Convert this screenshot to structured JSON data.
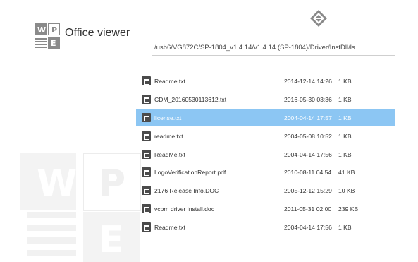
{
  "app": {
    "title": "Office viewer"
  },
  "path": "/usb6/VG872C/SP-1804_v1.4.14/v1.4.14 (SP-1804)/Driver/InstDll/ls",
  "files": [
    {
      "name": "Readme.txt",
      "date": "2014-12-14 14:26",
      "size": "1 KB",
      "selected": false
    },
    {
      "name": "CDM_20160530113612.txt",
      "date": "2016-05-30 03:36",
      "size": "1 KB",
      "selected": false
    },
    {
      "name": "license.txt",
      "date": "2004-04-14 17:57",
      "size": "1 KB",
      "selected": true
    },
    {
      "name": "readme.txt",
      "date": "2004-05-08 10:52",
      "size": "1 KB",
      "selected": false
    },
    {
      "name": "ReadMe.txt",
      "date": "2004-04-14 17:56",
      "size": "1 KB",
      "selected": false
    },
    {
      "name": "LogoVerificationReport.pdf",
      "date": "2010-08-11 04:54",
      "size": "41 KB",
      "selected": false
    },
    {
      "name": "2176 Release Info.DOC",
      "date": "2005-12-12 15:29",
      "size": "10 KB",
      "selected": false
    },
    {
      "name": "vcom driver install.doc",
      "date": "2011-05-31 02:00",
      "size": "239 KB",
      "selected": false
    },
    {
      "name": "Readme.txt",
      "date": "2004-04-14 17:56",
      "size": "1 KB",
      "selected": false
    }
  ],
  "icons": {
    "app_logo": "office-viewer-logo-icon",
    "top": "diamond-nav-icon",
    "file": "document-file-icon"
  },
  "colors": {
    "selection": "#8cc6f3",
    "icon": "#4b4b4b",
    "logo_tile": "#8a8a8a"
  }
}
